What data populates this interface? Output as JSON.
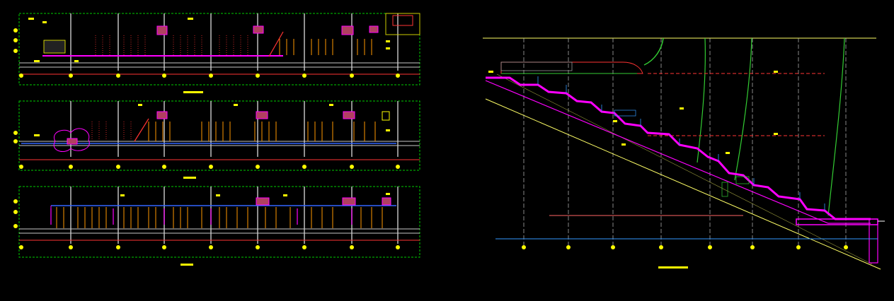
{
  "drawing": {
    "background": "#000000",
    "colors": {
      "frame": "#00cc00",
      "grid": "#c8c8c8",
      "axis_bubble": "#ffff00",
      "beam": "#ff3333",
      "accent": "#ff00ff",
      "annotation": "#ffffff",
      "leader": "#3399ff",
      "pipe": "#33cc33",
      "tag": "#ffff00"
    },
    "sheet_titles": [
      "",
      "",
      ""
    ],
    "section_title": "",
    "icons": [
      "axis-bubble-icon",
      "level-marker-icon",
      "dimension-tag-icon"
    ]
  }
}
